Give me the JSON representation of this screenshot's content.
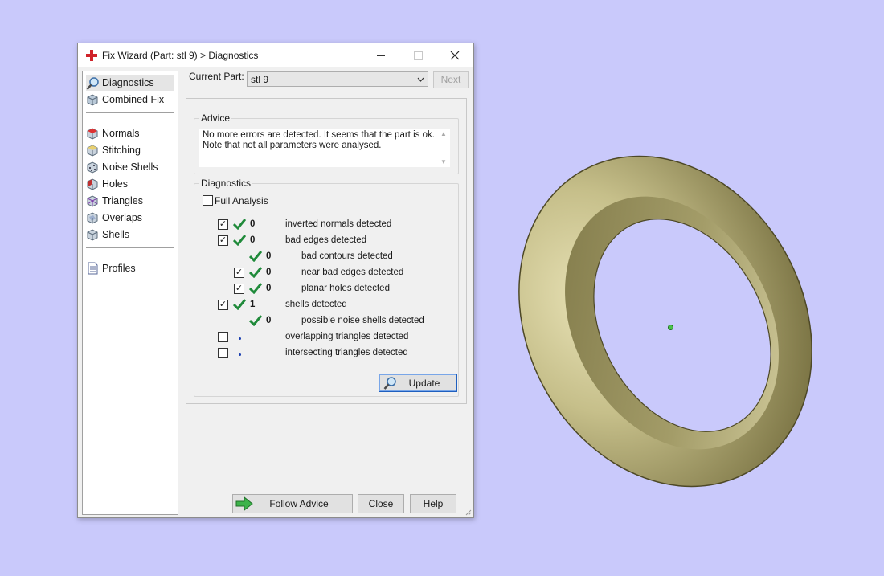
{
  "window": {
    "title": "Fix Wizard (Part: stl 9) > Diagnostics",
    "controls": {
      "minimize": "minimize",
      "maximize": "maximize",
      "close": "close"
    }
  },
  "nav": {
    "items": [
      {
        "label": "Diagnostics",
        "icon": "magnifier-icon",
        "selected": true
      },
      {
        "label": "Combined Fix",
        "icon": "combined-fix-icon"
      },
      {
        "label": "Normals",
        "icon": "normals-icon"
      },
      {
        "label": "Stitching",
        "icon": "stitching-icon"
      },
      {
        "label": "Noise Shells",
        "icon": "noise-shells-icon"
      },
      {
        "label": "Holes",
        "icon": "holes-icon"
      },
      {
        "label": "Triangles",
        "icon": "triangles-icon"
      },
      {
        "label": "Overlaps",
        "icon": "overlaps-icon"
      },
      {
        "label": "Shells",
        "icon": "shells-icon"
      },
      {
        "label": "Profiles",
        "icon": "profiles-icon"
      }
    ]
  },
  "current_part": {
    "label": "Current Part:",
    "value": "stl 9",
    "next_label": "Next"
  },
  "advice": {
    "title": "Advice",
    "line1": "No more errors are detected. It seems that the part is ok.",
    "line2": "Note that not all parameters were analysed."
  },
  "diagnostics": {
    "title": "Diagnostics",
    "full_analysis_label": "Full Analysis",
    "rows": [
      {
        "checkbox": true,
        "checked": true,
        "status": "ok",
        "count": "0",
        "label": "inverted normals detected"
      },
      {
        "checkbox": true,
        "checked": true,
        "status": "ok",
        "count": "0",
        "label": "bad edges detected"
      },
      {
        "checkbox": false,
        "checked": false,
        "status": "ok",
        "count": "0",
        "label": "bad contours detected"
      },
      {
        "checkbox": true,
        "checked": true,
        "status": "ok",
        "count": "0",
        "label": "near bad edges detected"
      },
      {
        "checkbox": true,
        "checked": true,
        "status": "ok",
        "count": "0",
        "label": "planar holes detected"
      },
      {
        "checkbox": true,
        "checked": true,
        "status": "ok",
        "count": "1",
        "label": "shells detected"
      },
      {
        "checkbox": false,
        "checked": false,
        "status": "ok",
        "count": "0",
        "label": "possible noise shells detected"
      },
      {
        "checkbox": true,
        "checked": false,
        "status": "pending",
        "count": "",
        "label": "overlapping triangles detected"
      },
      {
        "checkbox": true,
        "checked": false,
        "status": "pending",
        "count": "",
        "label": "intersecting triangles detected"
      }
    ],
    "update_label": "Update"
  },
  "buttons": {
    "follow_advice": "Follow Advice",
    "close": "Close",
    "help": "Help"
  },
  "colors": {
    "background": "#c9c9fb",
    "ring": "#c6bf8a",
    "check": "#1f8a3a",
    "close_icon": "#d0232a"
  }
}
